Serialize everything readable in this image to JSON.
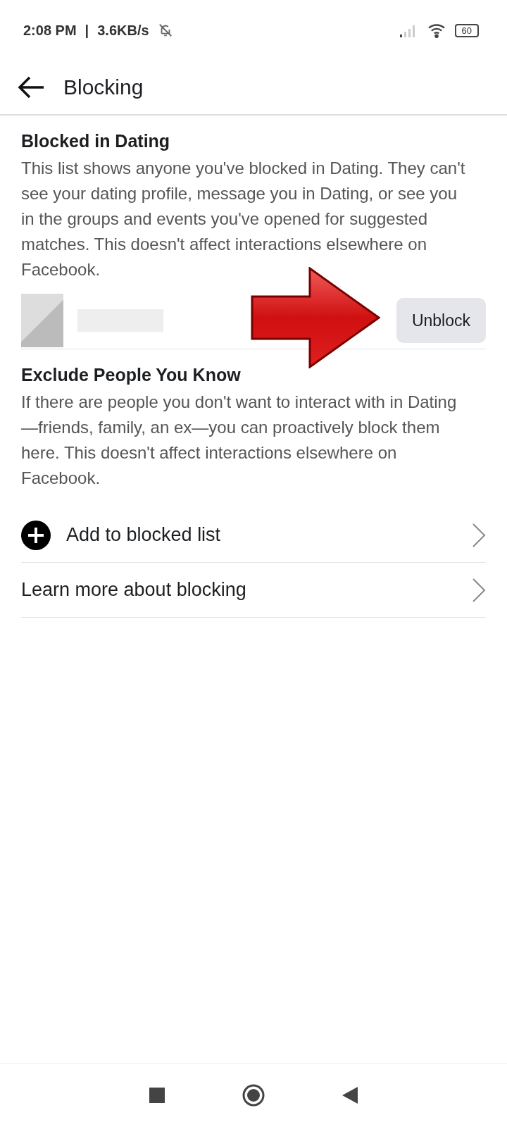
{
  "status_bar": {
    "time": "2:08 PM",
    "separator": "|",
    "speed": "3.6KB/s",
    "battery": "60"
  },
  "header": {
    "title": "Blocking"
  },
  "blocked_section": {
    "title": "Blocked in Dating",
    "description": "This list shows anyone you've blocked in Dating. They can't see your dating profile, message you in Dating, or see you in the groups and events you've opened for suggested matches. This doesn't affect interactions elsewhere on Facebook.",
    "users": [
      {
        "action": "Unblock"
      }
    ]
  },
  "exclude_section": {
    "title": "Exclude People You Know",
    "description": "If there are people you don't want to interact with in Dating—friends, family, an ex—you can proactively block them here. This doesn't affect interactions elsewhere on Facebook."
  },
  "actions": [
    {
      "kind": "add",
      "label": "Add to blocked list"
    },
    {
      "kind": "link",
      "label": "Learn more about blocking"
    }
  ]
}
